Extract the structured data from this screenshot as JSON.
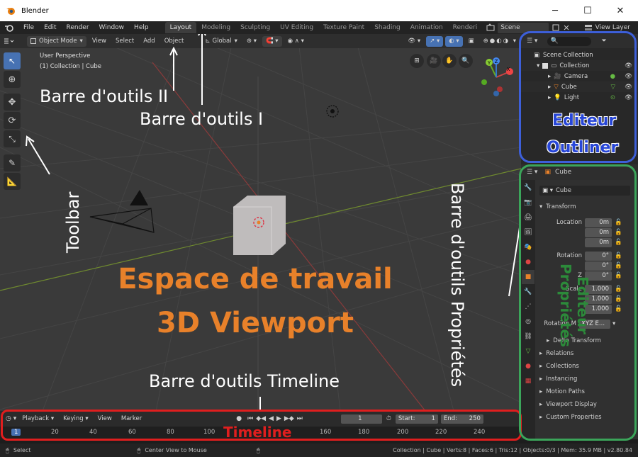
{
  "window": {
    "title": "Blender",
    "controls": {
      "minimize": "─",
      "maximize": "☐",
      "close": "✕"
    }
  },
  "menubar": {
    "items": [
      "File",
      "Edit",
      "Render",
      "Window",
      "Help"
    ],
    "workspaces": [
      "Layout",
      "Modeling",
      "Sculpting",
      "UV Editing",
      "Texture Paint",
      "Shading",
      "Animation",
      "Renderi"
    ],
    "active_workspace": "Layout",
    "scene": "Scene",
    "view_layer": "View Layer"
  },
  "viewport": {
    "header": {
      "mode": "Object Mode",
      "menus": [
        "View",
        "Select",
        "Add",
        "Object"
      ],
      "transform_orientation": "Global"
    },
    "info": {
      "perspective": "User Perspective",
      "collection": "(1) Collection | Cube"
    },
    "gizmo_axes": {
      "x": "X",
      "y": "Y",
      "z": "Z"
    }
  },
  "outliner": {
    "root": "Scene Collection",
    "items": [
      {
        "name": "Collection",
        "type": "collection"
      },
      {
        "name": "Camera",
        "type": "camera"
      },
      {
        "name": "Cube",
        "type": "mesh"
      },
      {
        "name": "Light",
        "type": "light"
      }
    ]
  },
  "properties": {
    "object_name": "Cube",
    "datablock_name": "Cube",
    "transform_panel": "Transform",
    "location_label": "Location",
    "location": [
      "0m",
      "0m",
      "0m"
    ],
    "rotation_label": "Rotation",
    "rotation": [
      "0°",
      "0°",
      "0°"
    ],
    "scale_label": "Scale",
    "scale": [
      "1.000",
      "1.000",
      "1.000"
    ],
    "rotation_mode_label": "Rotation M",
    "rotation_mode": "XYZ E...",
    "z_label": "Z",
    "subpanels": [
      "Delta Transform",
      "Relations",
      "Collections",
      "Instancing",
      "Motion Paths",
      "Viewport Display",
      "Custom Properties"
    ]
  },
  "timeline": {
    "menus": [
      "Playback",
      "Keying",
      "View",
      "Marker"
    ],
    "current_frame": "1",
    "start_label": "Start:",
    "start": "1",
    "end_label": "End:",
    "end": "250",
    "ruler_ticks": [
      "1",
      "20",
      "40",
      "60",
      "80",
      "100",
      "160",
      "180",
      "200",
      "220",
      "240"
    ]
  },
  "statusbar": {
    "select": "Select",
    "center_view": "Center View to Mouse",
    "stats": "Collection | Cube | Verts:8 | Faces:6 | Tris:12 | Objects:0/3 | Mem: 35.9 MB | v2.80.",
    "version_tail": "84"
  },
  "annotations": {
    "toolbar_2": "Barre d'outils II",
    "toolbar_1": "Barre d'outils I",
    "toolbar": "Toolbar",
    "workspace_line1": "Espace de travail",
    "workspace_line2": "3D Viewport",
    "timeline_toolbar": "Barre d'outils Timeline",
    "timeline": "Timeline",
    "outliner_line1": "Editeur",
    "outliner_line2": "Outliner",
    "properties_toolbar": "Barre d'outils Propriétés",
    "properties_editor": "Editeur Propriétés"
  },
  "colors": {
    "accent_blue": "#4772b3",
    "annotation_orange": "#e8812a",
    "frame_red": "#e01e1e",
    "frame_blue": "#3d5fd9",
    "frame_green": "#3ba55a"
  }
}
